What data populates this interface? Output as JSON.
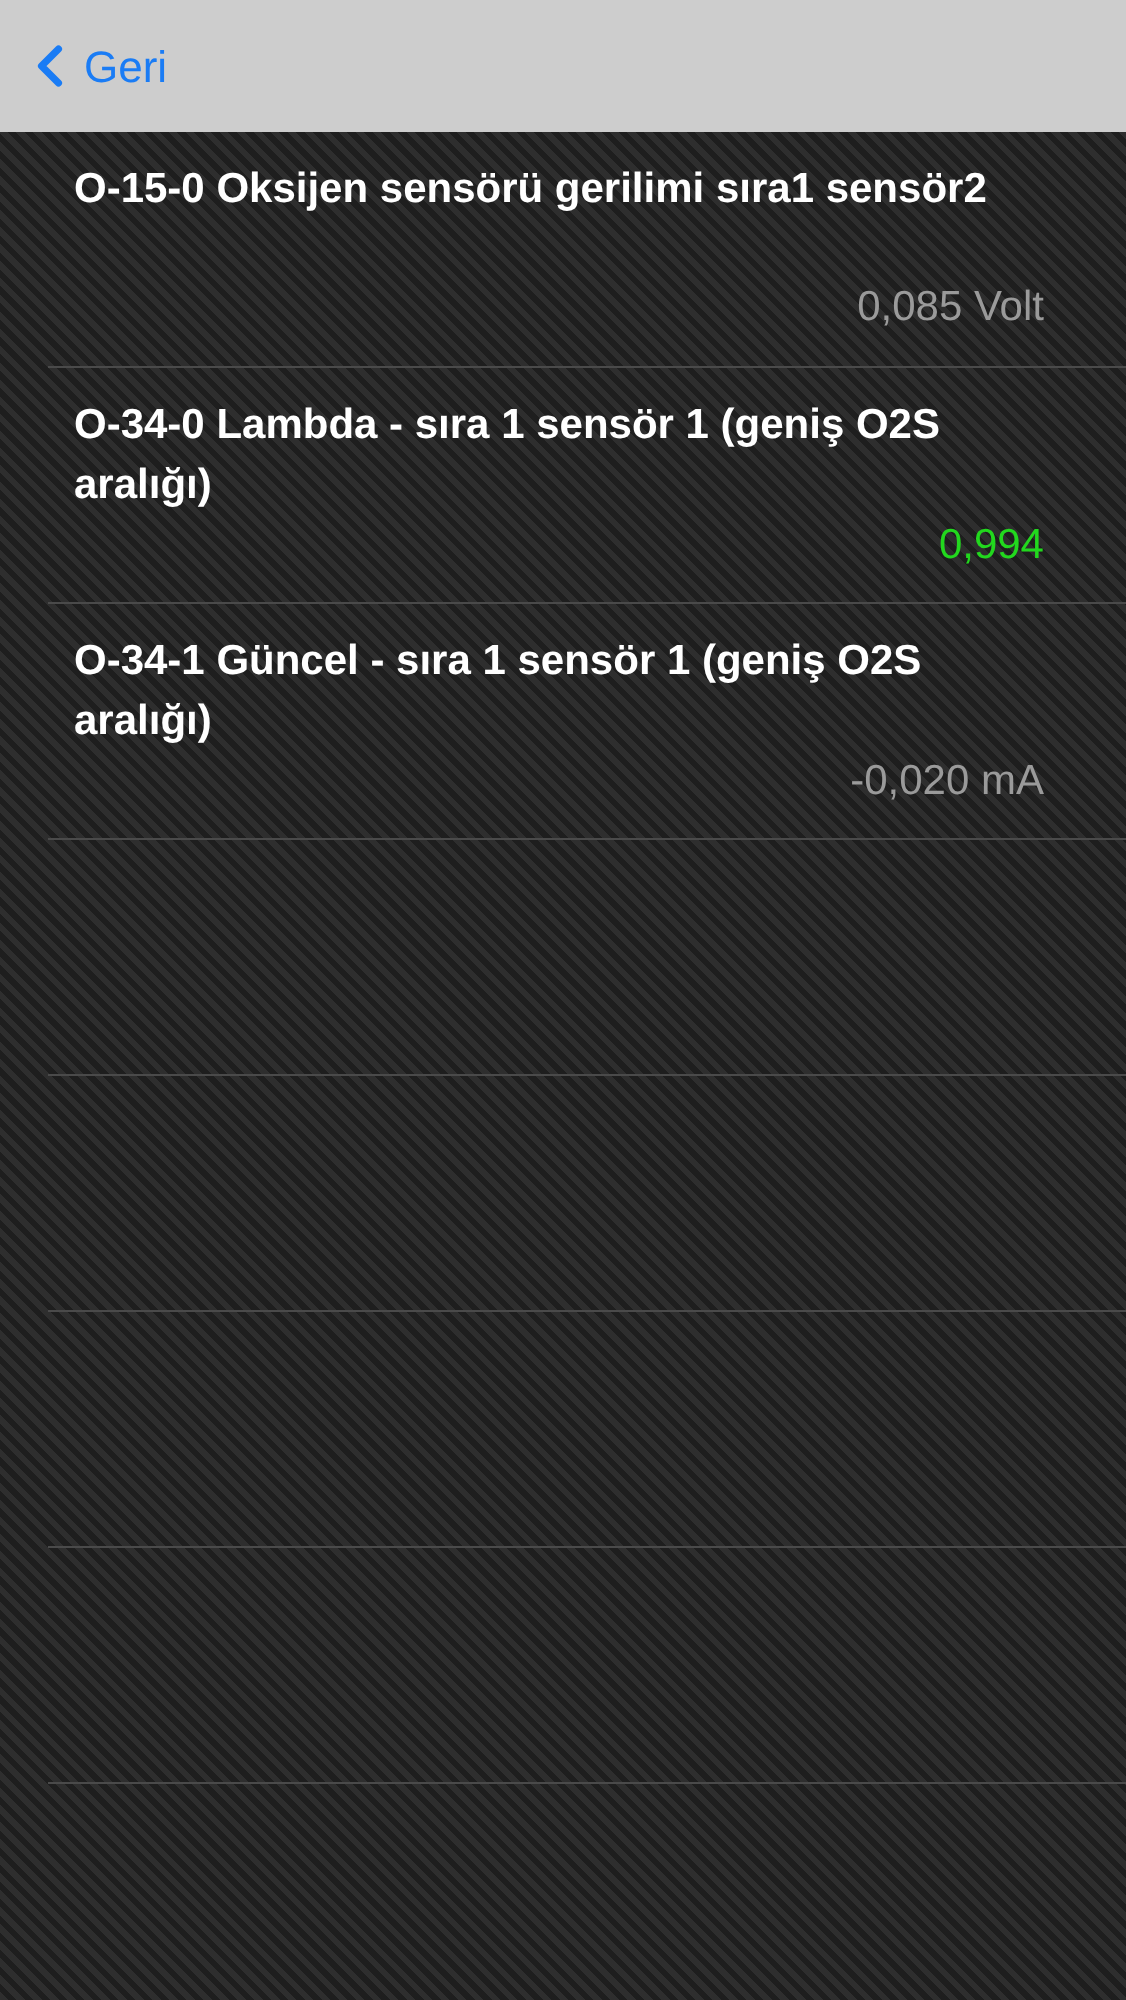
{
  "nav_bar": {
    "back_label": "Geri"
  },
  "readings": [
    {
      "title": "O-15-0 Oksijen sensörü gerilimi sıra1 sensör2",
      "value": "0,085 Volt",
      "color": "#9a9a9a"
    },
    {
      "title": "O-34-0 Lambda - sıra 1 sensör 1 (geniş O2S aralığı)",
      "value": "0,994",
      "color": "#22d81e"
    },
    {
      "title": "O-34-1 Güncel - sıra 1 sensör 1 (geniş O2S aralığı)",
      "value": "-0,020 mA",
      "color": "#9a9a9a"
    }
  ]
}
